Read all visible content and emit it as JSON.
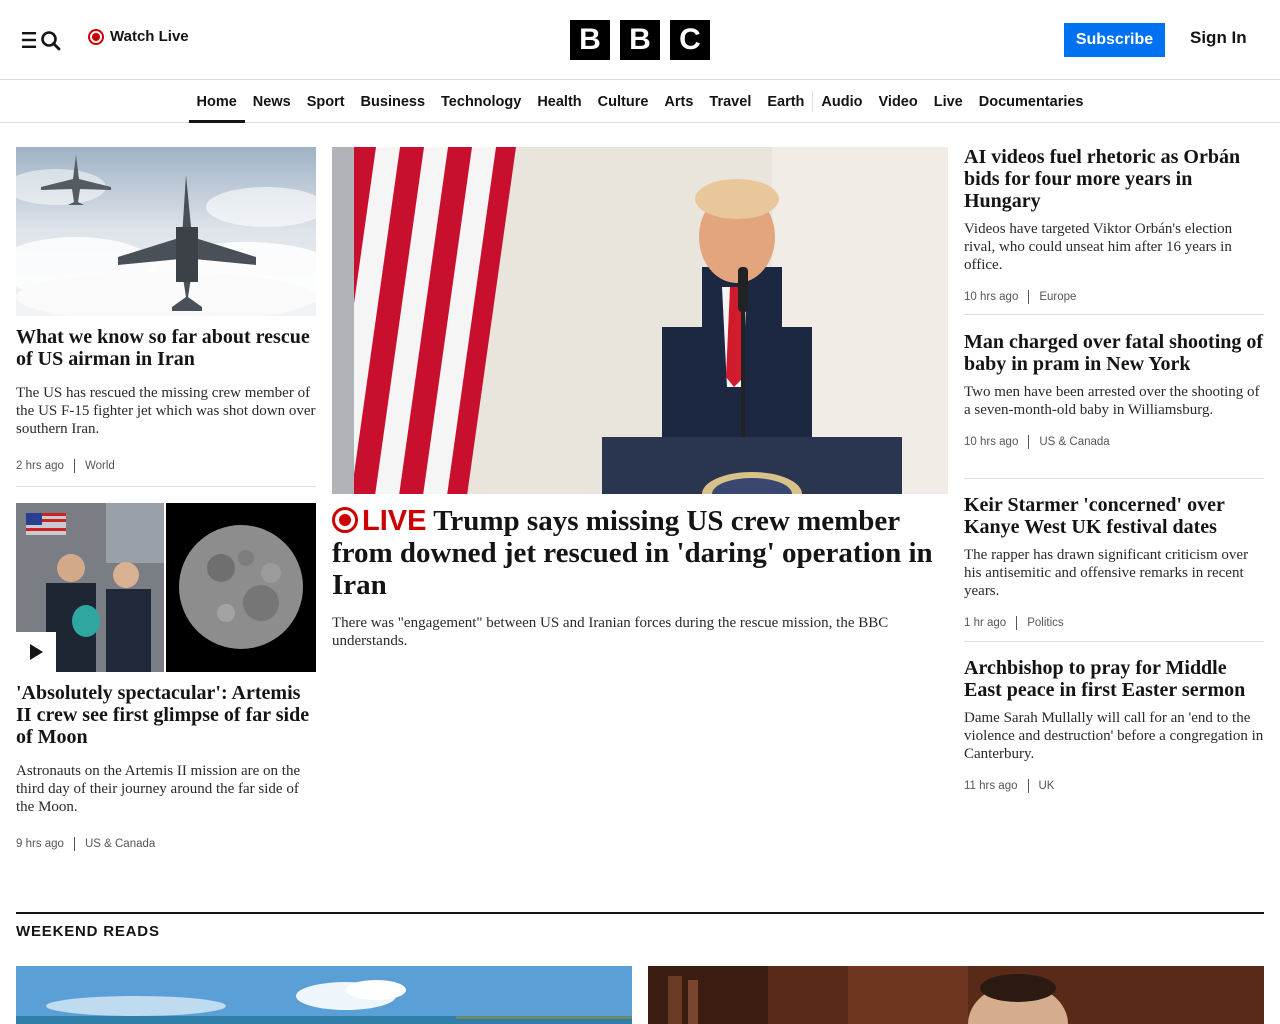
{
  "header": {
    "watch_live": "Watch Live",
    "logo": [
      "B",
      "B",
      "C"
    ],
    "subscribe": "Subscribe",
    "sign_in": "Sign In"
  },
  "nav": {
    "items": [
      "Home",
      "News",
      "Sport",
      "Business",
      "Technology",
      "Health",
      "Culture",
      "Arts",
      "Travel",
      "Earth",
      "Audio",
      "Video",
      "Live",
      "Documentaries"
    ],
    "active": "Home"
  },
  "left": {
    "story1": {
      "headline": "What we know so far about rescue of US airman in Iran",
      "summary": "The US has rescued the missing crew member of the US F-15 fighter jet which was shot down over southern Iran.",
      "time": "2 hrs ago",
      "tag": "World"
    },
    "story2": {
      "headline": "'Absolutely spectacular': Artemis II crew see first glimpse of far side of Moon",
      "summary": "Astronauts on the Artemis II mission are on the third day of their journey around the far side of the Moon.",
      "time": "9 hrs ago",
      "tag": "US & Canada"
    }
  },
  "main": {
    "live_label": "LIVE",
    "headline": "Trump says missing US crew member from downed jet rescued in 'daring' operation in Iran",
    "summary": "There was \"engagement\" between US and Iranian forces during the rescue mission, the BBC understands."
  },
  "right": [
    {
      "headline": "AI videos fuel rhetoric as Orbán bids for four more years in Hungary",
      "summary": "Videos have targeted Viktor Orbán's election rival, who could unseat him after 16 years in office.",
      "time": "10 hrs ago",
      "tag": "Europe"
    },
    {
      "headline": "Man charged over fatal shooting of baby in pram in New York",
      "summary": "Two men have been arrested over the shooting of a seven-month-old baby in Williamsburg.",
      "time": "10 hrs ago",
      "tag": "US & Canada"
    },
    {
      "headline": "Keir Starmer 'concerned' over Kanye West UK festival dates",
      "summary": "The rapper has drawn significant criticism over his antisemitic and offensive remarks in recent years.",
      "time": "1 hr ago",
      "tag": "Politics"
    },
    {
      "headline": "Archbishop to pray for Middle East peace in first Easter sermon",
      "summary": "Dame Sarah Mullally will call for an 'end to the violence and destruction' before a congregation in Canterbury.",
      "time": "11 hrs ago",
      "tag": "UK"
    }
  ],
  "weekend": {
    "title": "WEEKEND READS"
  },
  "colors": {
    "accent_blue": "#0071f1",
    "live_red": "#cc0000",
    "text": "#141414"
  },
  "icons": {
    "menu": "menu-search-icon",
    "live": "live-dot-icon",
    "play": "play-icon"
  }
}
